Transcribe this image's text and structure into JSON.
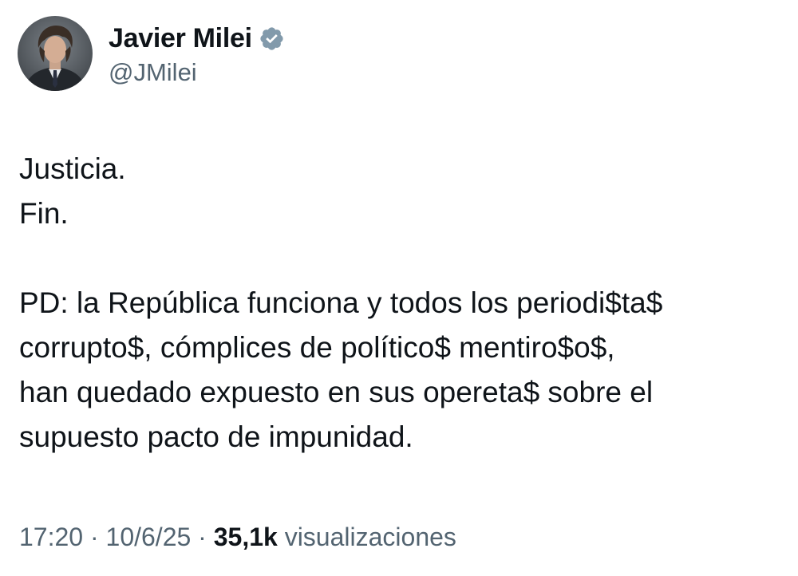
{
  "author": {
    "display_name": "Javier Milei",
    "handle": "@JMilei",
    "verified_icon": "verified-badge-icon",
    "badge_color": "#829aab"
  },
  "tweet": {
    "lines": [
      "Justicia.",
      "Fin.",
      "",
      "PD: la República funciona y todos los periodi$ta$",
      "corrupto$, cómplices de político$ mentiro$o$,",
      "han quedado expuesto en sus opereta$ sobre el",
      "supuesto pacto de impunidad."
    ]
  },
  "meta": {
    "time": "17:20",
    "separator": "·",
    "date": "10/6/25",
    "views_count": "35,1k",
    "views_label": "visualizaciones"
  },
  "colors": {
    "text_primary": "#0f1419",
    "text_secondary": "#536471",
    "background": "#ffffff"
  }
}
